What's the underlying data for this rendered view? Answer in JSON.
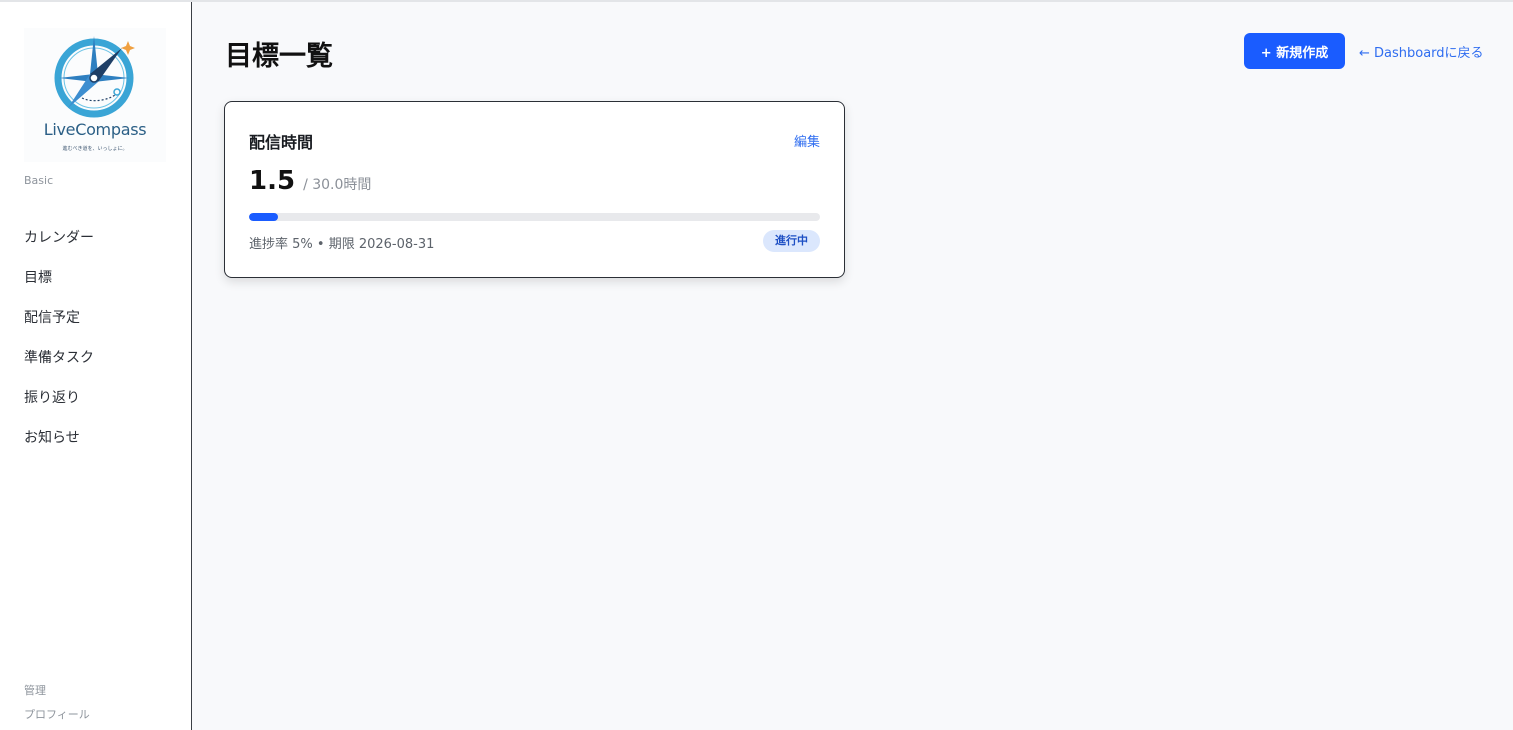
{
  "sidebar": {
    "logo": {
      "name": "LiveCompass",
      "tagline": "進むべき道を、いっしょに。"
    },
    "plan": "Basic",
    "items": [
      {
        "label": "カレンダー"
      },
      {
        "label": "目標"
      },
      {
        "label": "配信予定"
      },
      {
        "label": "準備タスク"
      },
      {
        "label": "振り返り"
      },
      {
        "label": "お知らせ"
      }
    ],
    "footer": [
      {
        "label": "管理"
      },
      {
        "label": "プロフィール"
      }
    ]
  },
  "header": {
    "title": "目標一覧",
    "new_button": "+ 新規作成",
    "back_link": "← Dashboardに戻る"
  },
  "goals": [
    {
      "title": "配信時間",
      "edit_label": "編集",
      "current": "1.5",
      "target": "/ 30.0時間",
      "progress_percent": 5,
      "meta": "進捗率 5% • 期限 2026-08-31",
      "status": "進行中"
    }
  ],
  "colors": {
    "accent": "#1a5cff",
    "link": "#2f6df0",
    "badge_bg": "#dbe7fd",
    "badge_text": "#1d4fc4"
  },
  "icons": {
    "logo": "compass-icon"
  }
}
